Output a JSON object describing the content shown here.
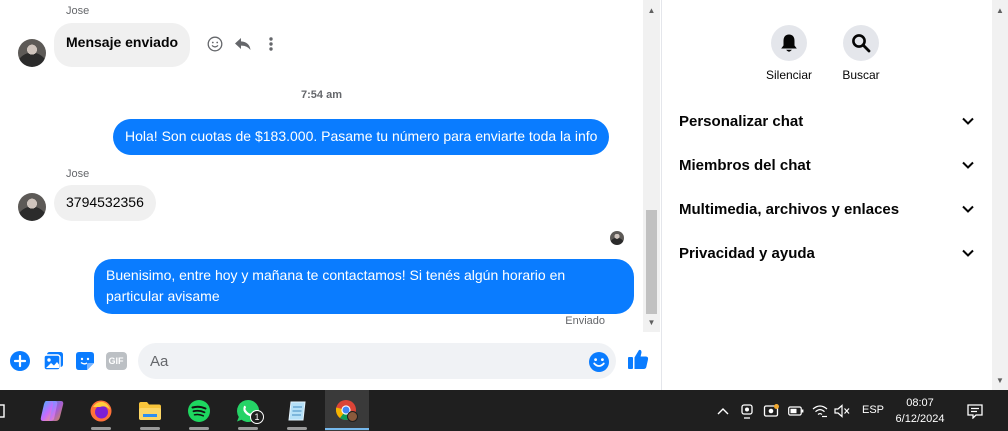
{
  "chat": {
    "messages": [
      {
        "sender": "Jose",
        "text": "Mensaje enviado",
        "direction": "in"
      },
      {
        "text": "Hola! Son cuotas de $183.000. Pasame tu número para enviarte toda la info",
        "direction": "out"
      },
      {
        "sender": "Jose",
        "text": "3794532356",
        "direction": "in"
      },
      {
        "text": "Buenisimo, entre hoy y mañana te contactamos! Si tenés algún horario en particular avisame",
        "direction": "out"
      }
    ],
    "timestamp": "7:54 am",
    "status": "Enviado"
  },
  "composer": {
    "placeholder": "Aa",
    "gif_label": "GIF"
  },
  "panel": {
    "actions": [
      {
        "label": "Silenciar",
        "icon": "bell-icon"
      },
      {
        "label": "Buscar",
        "icon": "search-icon"
      }
    ],
    "sections": [
      {
        "label": "Personalizar chat"
      },
      {
        "label": "Miembros del chat"
      },
      {
        "label": "Multimedia, archivos y enlaces"
      },
      {
        "label": "Privacidad y ayuda"
      }
    ]
  },
  "taskbar": {
    "apps": [
      "task-view",
      "copilot",
      "firefox",
      "file-explorer",
      "spotify",
      "whatsapp",
      "notepad",
      "chrome"
    ],
    "whatsapp_badge": "1",
    "language": "ESP",
    "time": "08:07",
    "date": "6/12/2024"
  },
  "colors": {
    "accent": "#0a7cff",
    "incoming_bubble": "#f0f0f0",
    "taskbar": "#1f1f1f"
  }
}
